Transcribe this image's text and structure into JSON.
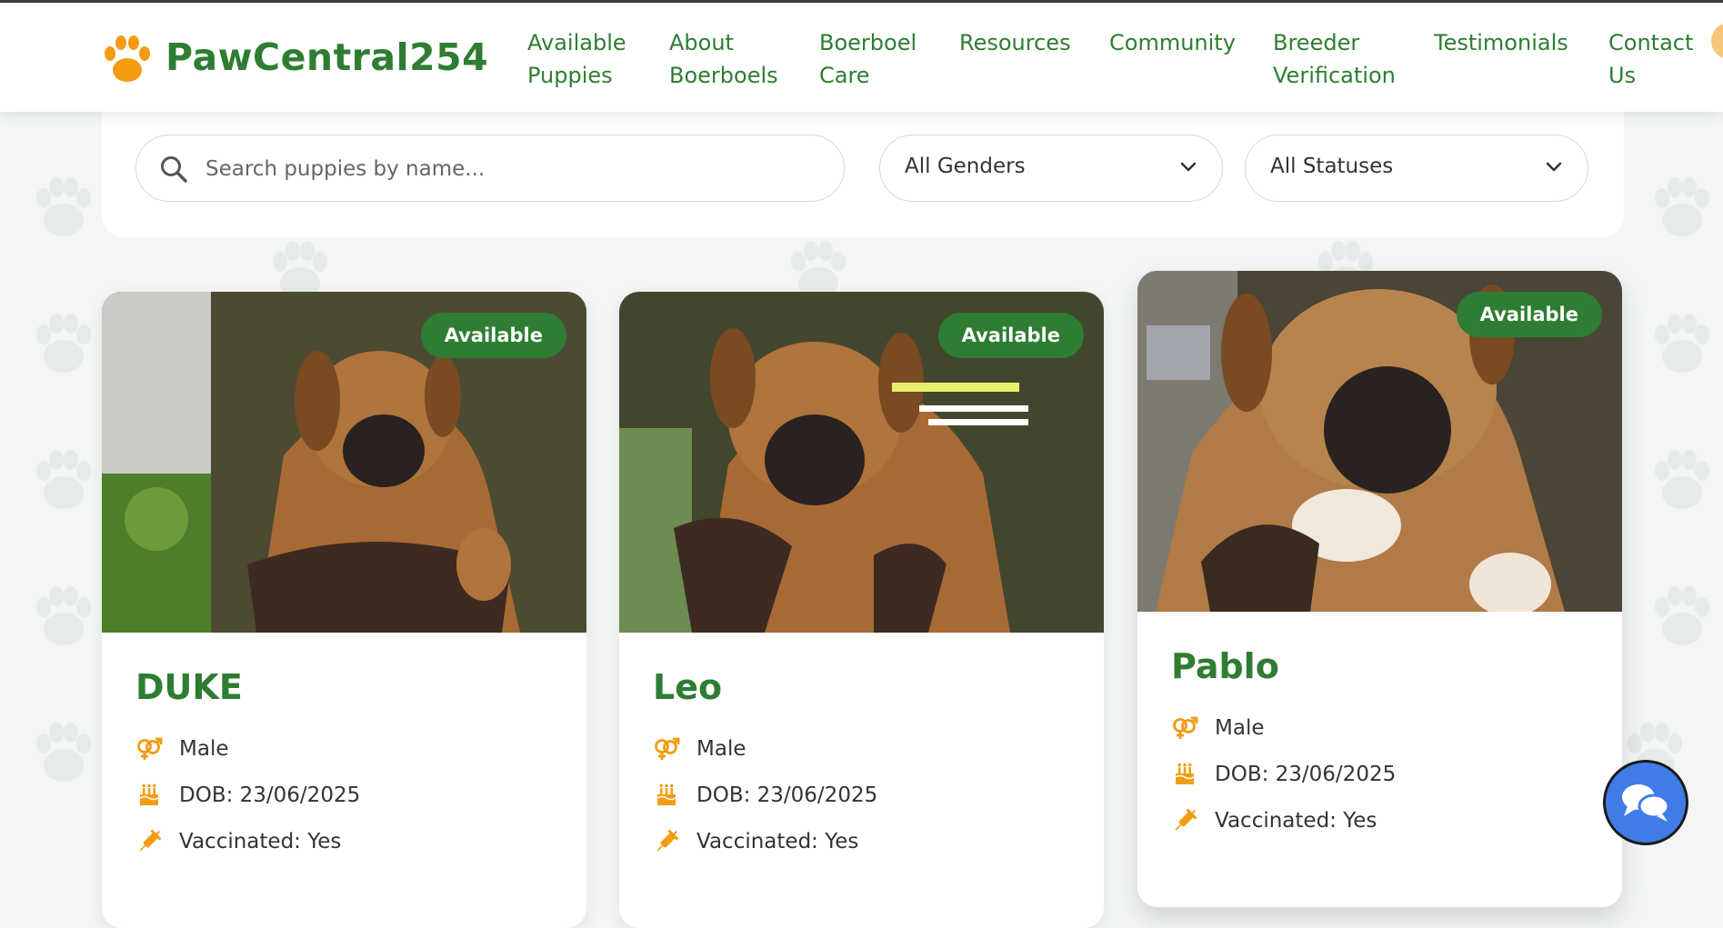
{
  "header": {
    "brand": "PawCentral254",
    "nav": [
      {
        "label": "Available\nPuppies"
      },
      {
        "label": "About\nBoerboels"
      },
      {
        "label": "Boerboel\nCare"
      },
      {
        "label": "Resources"
      },
      {
        "label": "Community"
      },
      {
        "label": "Breeder\nVerification"
      },
      {
        "label": "Testimonials"
      },
      {
        "label": "Contact\nUs"
      }
    ]
  },
  "filters": {
    "search_placeholder": "Search puppies by name...",
    "gender": "All Genders",
    "status": "All Statuses"
  },
  "puppies": [
    {
      "name": "DUKE",
      "status": "Available",
      "gender": "Male",
      "dob": "DOB: 23/06/2025",
      "vaccinated": "Vaccinated: Yes"
    },
    {
      "name": "Leo",
      "status": "Available",
      "gender": "Male",
      "dob": "DOB: 23/06/2025",
      "vaccinated": "Vaccinated: Yes"
    },
    {
      "name": "Pablo",
      "status": "Available",
      "gender": "Male",
      "dob": "DOB: 23/06/2025",
      "vaccinated": "Vaccinated: Yes"
    }
  ],
  "colors": {
    "brand_green": "#2e7d32",
    "accent_orange": "#f39c12",
    "chat_blue": "#3f7ce8"
  },
  "icons": {
    "logo": "paw-icon",
    "search": "search-icon",
    "select": "chevron-down-icon",
    "gender": "gender-icon",
    "dob": "birthday-cake-icon",
    "vaccinated": "syringe-icon",
    "chat": "chat-bubbles-icon"
  }
}
